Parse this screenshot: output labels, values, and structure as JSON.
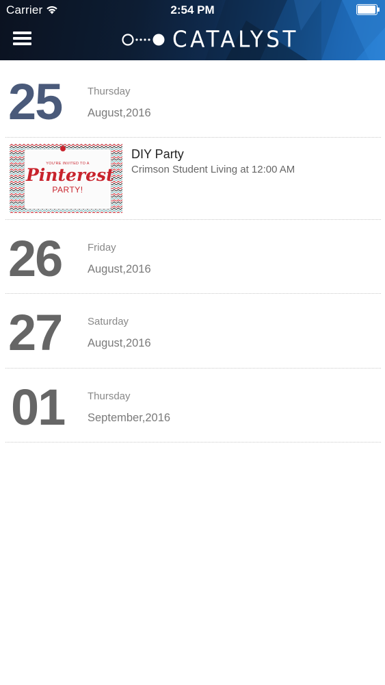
{
  "status_bar": {
    "carrier": "Carrier",
    "time": "2:54 PM",
    "wifi_icon": "wifi-icon",
    "battery_icon": "battery-icon"
  },
  "header": {
    "menu_icon": "hamburger-menu-icon",
    "brand_logo_icon": "catalyst-logo-icon",
    "brand_name": "CATALYST"
  },
  "days": [
    {
      "day": "25",
      "weekday": "Thursday",
      "month_year": "August,2016",
      "color": "#4a5a7a",
      "events": [
        {
          "title": "DIY Party",
          "subtitle": "Crimson Student Living at 12:00 AM",
          "thumbnail": {
            "top_text": "YOU'RE INVITED TO A",
            "brand_text": "Pinterest",
            "bottom_text": "PARTY!"
          }
        }
      ]
    },
    {
      "day": "26",
      "weekday": "Friday",
      "month_year": "August,2016",
      "color": "#666666",
      "events": []
    },
    {
      "day": "27",
      "weekday": "Saturday",
      "month_year": "August,2016",
      "color": "#666666",
      "events": []
    },
    {
      "day": "01",
      "weekday": "Thursday",
      "month_year": "September,2016",
      "color": "#666666",
      "events": []
    }
  ],
  "colors": {
    "header_dark": "#0b1220",
    "header_accent": "#2a82d6",
    "highlight_day": "#4a5a7a",
    "pinterest_red": "#c8232c"
  }
}
